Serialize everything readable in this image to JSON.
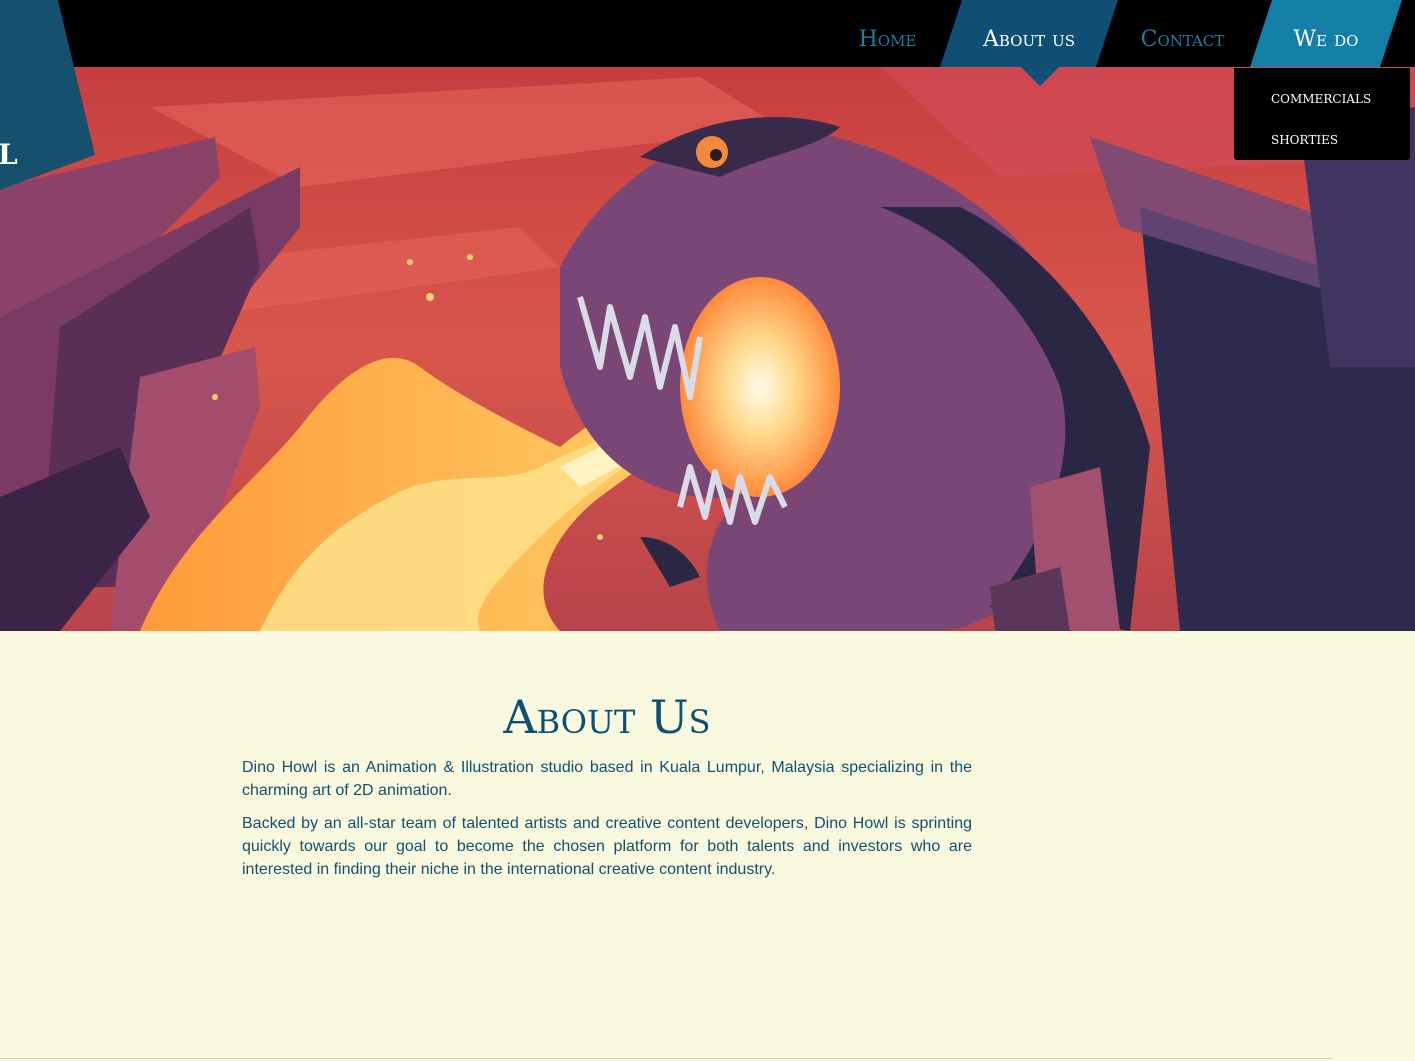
{
  "logo": {
    "partial_letter": "L"
  },
  "nav": {
    "items": [
      {
        "label": "Home"
      },
      {
        "label": "About us"
      },
      {
        "label": "Contact"
      },
      {
        "label": "We do"
      }
    ],
    "active": "About us",
    "dropdown": {
      "items": [
        "commercials",
        "shorties"
      ]
    }
  },
  "hero": {
    "image": "dinosaur-breathing-fire-illustration"
  },
  "about": {
    "title": "About Us",
    "paragraphs": [
      "Dino Howl is an Animation & Illustration studio based in Kuala Lumpur, Malaysia specializing in the charming art of 2D animation.",
      "Backed by an all-star team of talented artists and creative content developers, Dino Howl is sprinting quickly towards our goal to become the chosen platform for both talents and investors who are interested in finding their niche in the international creative content industry."
    ]
  },
  "colors": {
    "primary": "#0f4f74",
    "accent": "#137fa6",
    "nav_link": "#1a7fa3",
    "background": "#f9f9df",
    "header": "#000000"
  }
}
